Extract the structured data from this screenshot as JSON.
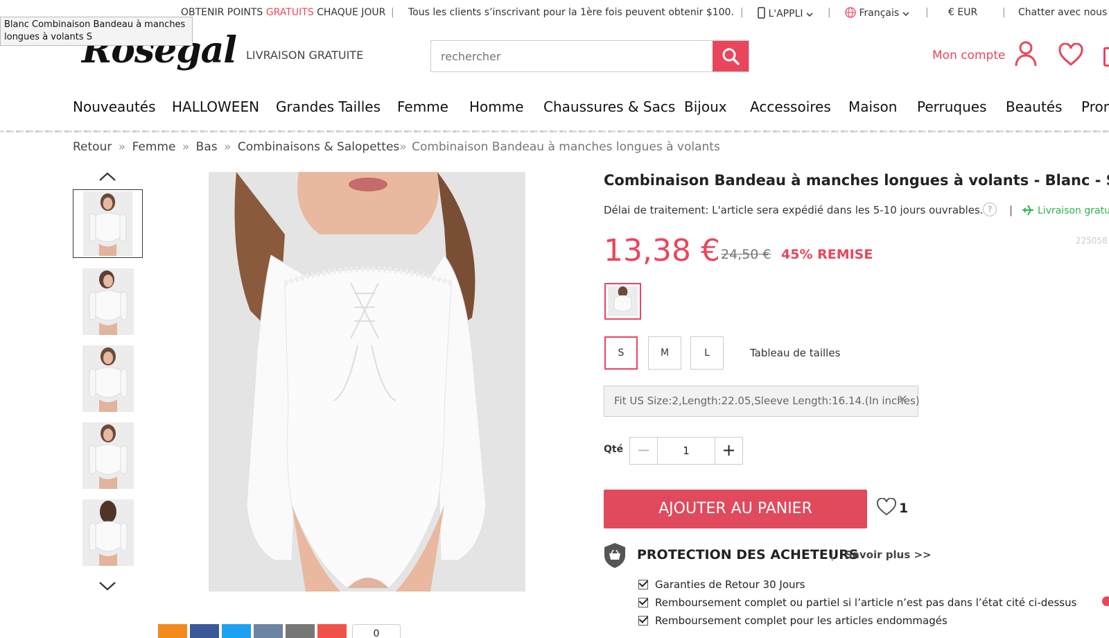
{
  "topbar": {
    "promo_a": "OBTENIR POINTS ",
    "promo_b": "GRATUITS",
    "promo_c": " CHAQUE JOUR",
    "signup_offer": "Tous les clients s’inscrivant pour la 1ère fois peuvent obtenir $100.",
    "app": "L'APPLI",
    "language": "Français",
    "currency": "€ EUR",
    "chat": "Chatter avec nous",
    "sep": "|"
  },
  "tooltip": "Blanc Combinaison Bandeau à manches longues à volants S",
  "header": {
    "logo": "Rosegal",
    "free_shipping": "LIVRAISON GRATUITE",
    "search_placeholder": "rechercher",
    "account": "Mon compte"
  },
  "nav": [
    "Nouveautés",
    "HALLOWEEN",
    "Grandes Tailles",
    "Femme",
    "Homme",
    "Chaussures & Sacs",
    "Bijoux",
    "Accessoires",
    "Maison",
    "Perruques",
    "Beautés",
    "Prom"
  ],
  "breadcrumb": {
    "items": [
      "Retour",
      "Femme",
      "Bas",
      "Combinaisons & Salopettes"
    ],
    "current": "Combinaison Bandeau à manches longues à volants",
    "arrow": "»"
  },
  "product": {
    "title": "Combinaison Bandeau à manches longues à volants - Blanc - S",
    "delay": "Délai de traitement: L'article sera expédié dans les 5-10 jours ouvrables.",
    "help": "?",
    "free_shipping": "Livraison gratuite",
    "sku": "225058",
    "price": "13,38 €",
    "old_price": "24,50 €",
    "discount": "45% REMISE",
    "sizes": [
      "S",
      "M",
      "L"
    ],
    "selected_size": "S",
    "size_chart": "Tableau de tailles",
    "fit": "Fit US Size:2,Length:22.05,Sleeve Length:16.14.(In inches)",
    "fit_close": "✕",
    "qty_label": "Qté",
    "qty_value": "1",
    "qty_minus": "−",
    "qty_plus": "+",
    "add_to_cart": "AJOUTER AU PANIER",
    "wish_count": "1"
  },
  "protection": {
    "title": "PROTECTION DES ACHETEURS",
    "sep": "|",
    "more": "Savoir plus >>",
    "items": [
      "Garanties de Retour 30 Jours",
      "Remboursement complet ou partiel si l’article n’est pas dans l’état cité ci-dessus",
      "Remboursement complet pour les articles endommagés"
    ]
  },
  "social": {
    "count": "0"
  },
  "colors": {
    "accent": "#e9465c",
    "green": "#2bb34b"
  }
}
